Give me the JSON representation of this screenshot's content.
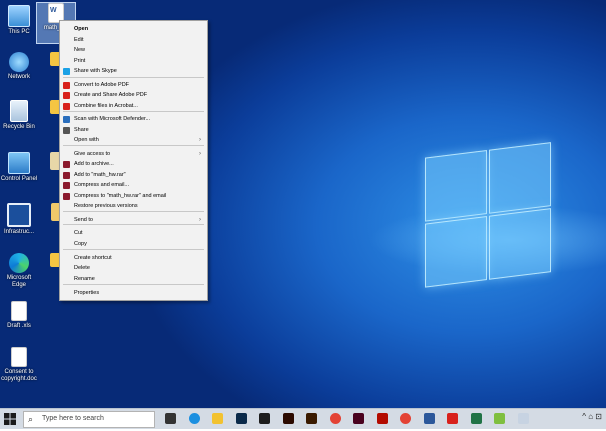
{
  "desktop_icons": [
    {
      "label": "This PC",
      "name": "this-pc"
    },
    {
      "label": "Network",
      "name": "network"
    },
    {
      "label": "Recycle Bin",
      "name": "recycle-bin"
    },
    {
      "label": "Control Panel",
      "name": "control-panel"
    },
    {
      "label": "Infrastruc...",
      "name": "infrastructure"
    },
    {
      "label": "Microsoft Edge",
      "name": "microsoft-edge"
    },
    {
      "label": "Draft .xls",
      "name": "draft-xls"
    },
    {
      "label": "Consent to copyright.doc",
      "name": "consent-doc"
    },
    {
      "label": "math_hw",
      "name": "math-hw-doc"
    }
  ],
  "context_menu": {
    "items": [
      {
        "label": "Open",
        "bold": true
      },
      {
        "label": "Edit"
      },
      {
        "label": "New"
      },
      {
        "label": "Print"
      },
      {
        "label": "Share with Skype",
        "icon": "skype-icon",
        "color": "#1aa1e6"
      },
      {
        "label": "Convert to Adobe PDF",
        "icon": "acrobat-icon",
        "color": "#d8211c"
      },
      {
        "label": "Create and Share Adobe PDF",
        "icon": "acrobat-icon",
        "color": "#d8211c"
      },
      {
        "label": "Combine files in Acrobat...",
        "icon": "acrobat-icon",
        "color": "#d8211c"
      },
      {
        "label": "Scan with Microsoft Defender...",
        "icon": "shield-icon",
        "color": "#2a6ebd"
      },
      {
        "label": "Share",
        "icon": "share-icon",
        "color": "#555555"
      },
      {
        "label": "Open with",
        "submenu": true
      },
      {
        "label": "Give access to",
        "submenu": true
      },
      {
        "label": "Add to archive...",
        "icon": "winrar-icon",
        "color": "#8b1a2e"
      },
      {
        "label": "Add to \"math_hw.rar\"",
        "icon": "winrar-icon",
        "color": "#8b1a2e"
      },
      {
        "label": "Compress and email...",
        "icon": "winrar-icon",
        "color": "#8b1a2e"
      },
      {
        "label": "Compress to \"math_hw.rar\" and email",
        "icon": "winrar-icon",
        "color": "#8b1a2e"
      },
      {
        "label": "Restore previous versions"
      },
      {
        "label": "Send to",
        "submenu": true
      },
      {
        "label": "Cut"
      },
      {
        "label": "Copy"
      },
      {
        "label": "Create shortcut"
      },
      {
        "label": "Delete"
      },
      {
        "label": "Rename"
      },
      {
        "label": "Properties"
      }
    ]
  },
  "taskbar": {
    "search_placeholder": "Type here to search",
    "apps": [
      "task-view",
      "edge",
      "file-explorer",
      "photoshop",
      "terminal",
      "illustrator",
      "illustrator-alt",
      "chrome",
      "indesign",
      "acrobat-reader",
      "chrome-alt",
      "word",
      "acrobat",
      "excel",
      "paint",
      "snipping-tool"
    ],
    "tray_text": "^ ⌂ ⊡"
  },
  "colors": {
    "accent": "#0b5cc4",
    "menu_bg": "#f2f2f2",
    "taskbar_bg": "#d4dbe4"
  }
}
